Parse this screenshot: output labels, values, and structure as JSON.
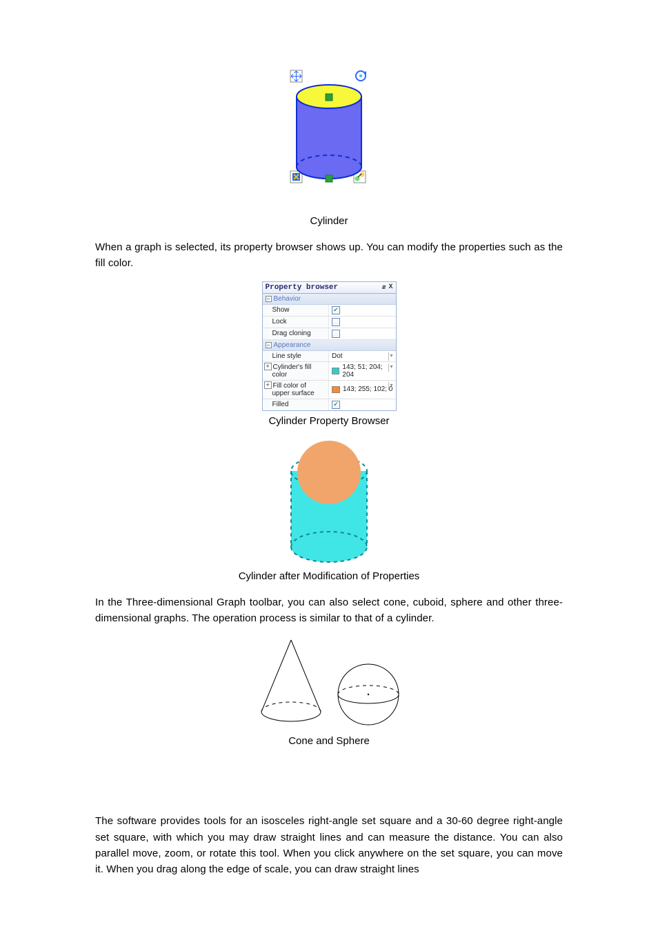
{
  "captions": {
    "cylinder": "Cylinder",
    "prop_browser": "Cylinder Property Browser",
    "modified": "Cylinder after Modification of Properties",
    "cone_sphere": "Cone and Sphere"
  },
  "paragraphs": {
    "p1": "When a graph is selected, its property browser shows up.  You can modify the properties such as the fill color.",
    "p2": "In the Three-dimensional Graph toolbar, you can also select cone, cuboid, sphere and other three-dimensional graphs. The operation process is similar to that of a cylinder.",
    "p3": "The software provides tools for an isosceles right-angle set square and a 30-60 degree right-angle set square, with which you may draw straight lines and can measure the distance. You can also parallel move, zoom, or rotate this tool. When you click anywhere on the set square, you can move it. When you drag along the edge of scale, you can draw straight lines"
  },
  "property_browser": {
    "title": "Property browser",
    "ctrl_pin": "⇵",
    "ctrl_close": "X",
    "sections": {
      "behavior": "Behavior",
      "appearance": "Appearance"
    },
    "rows": {
      "show": {
        "label": "Show",
        "checked": true
      },
      "lock": {
        "label": "Lock",
        "checked": false
      },
      "drag_cloning": {
        "label": "Drag cloning",
        "checked": false
      },
      "line_style": {
        "label": "Line style",
        "value": "Dot"
      },
      "cyl_fill": {
        "label": "Cylinder's fill color",
        "value": "143; 51; 204; 204",
        "swatch": "#33cccc"
      },
      "upper_fill": {
        "label": "Fill color of upper surface",
        "value": "143; 255; 102; 0",
        "swatch": "#ff8a2a"
      },
      "filled": {
        "label": "Filled",
        "checked": true
      }
    }
  },
  "figures": {
    "cyl_selected": {
      "body_fill": "#6a6af2",
      "top_fill": "#f8f83a",
      "outline": "#0b2fd6",
      "handle": "#2e9c3b"
    },
    "cyl_modified": {
      "body_fill": "#40e6e6",
      "top_fill": "#f2a56a",
      "outline": "#1aa9b4"
    }
  }
}
